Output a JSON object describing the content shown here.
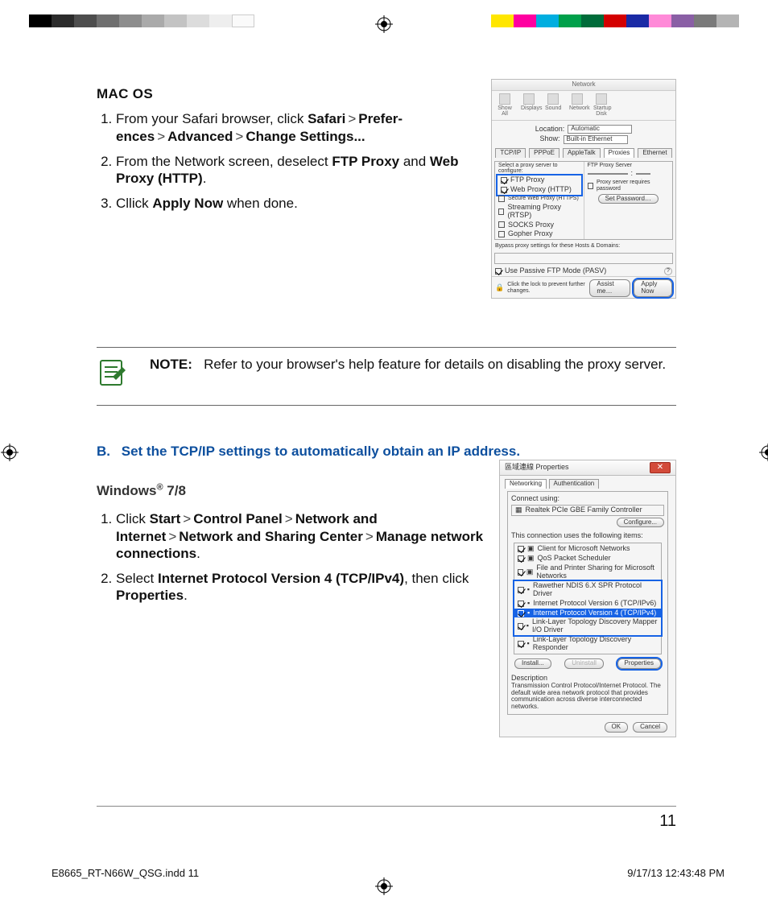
{
  "section_mac": {
    "heading": "MAC OS",
    "steps": [
      {
        "pre": "From your Safari browser, click ",
        "path": [
          "Safari",
          "Prefer-",
          "ences",
          "Advanced",
          "Change  Settings..."
        ]
      },
      {
        "pre": "From the Network screen, deselect ",
        "bold1": "FTP Proxy",
        "mid": " and ",
        "bold2": "Web Proxy (HTTP)",
        "post": "."
      },
      {
        "pre": "Cllick ",
        "bold1": "Apply Now",
        "post": " when done."
      }
    ]
  },
  "note": {
    "label": "NOTE:",
    "text": "Refer to your browser's help feature for details on disabling the proxy server."
  },
  "section_b": {
    "label": "B.",
    "text": "Set the TCP/IP settings to automatically obtain an IP address."
  },
  "section_win": {
    "heading_pre": "Windows",
    "heading_sup": "®",
    "heading_post": " 7/8",
    "steps": [
      {
        "pre": "Click ",
        "path": [
          "Start",
          "Control Panel",
          "Network and Internet",
          "Network and Sharing Center",
          "Manage network connections"
        ],
        "post": "."
      },
      {
        "pre": "Select ",
        "bold1": "Internet Protocol Version 4 (TCP/IPv4)",
        "mid": ", then click ",
        "bold2": "Properties",
        "post": "."
      }
    ]
  },
  "fig_mac": {
    "title": "Network",
    "toolbar": [
      "Show All",
      "Displays",
      "Sound",
      "Network",
      "Startup Disk"
    ],
    "location_label": "Location:",
    "location_value": "Automatic",
    "show_label": "Show:",
    "show_value": "Built-in Ethernet",
    "tabs": [
      "TCP/IP",
      "PPPoE",
      "AppleTalk",
      "Proxies",
      "Ethernet"
    ],
    "left_label": "Select a proxy server to configure:",
    "right_label": "FTP Proxy Server",
    "right_check": "Proxy server requires password",
    "right_btn": "Set Password…",
    "proxies": [
      "FTP Proxy",
      "Web Proxy (HTTP)",
      "Secure Web Proxy (HTTPS)",
      "Streaming Proxy (RTSP)",
      "SOCKS Proxy",
      "Gopher Proxy"
    ],
    "bypass": "Bypass proxy settings for these Hosts & Domains:",
    "pasv": "Use Passive FTP Mode (PASV)",
    "lock": "Click the lock to prevent further changes.",
    "assist": "Assist me…",
    "apply": "Apply Now"
  },
  "fig_win": {
    "title": "區域連線 Properties",
    "tabs": [
      "Networking",
      "Authentication"
    ],
    "connect": "Connect using:",
    "adapter": "Realtek PCIe GBE Family Controller",
    "configure": "Configure...",
    "uses": "This connection uses the following items:",
    "items": [
      "Client for Microsoft Networks",
      "QoS Packet Scheduler",
      "File and Printer Sharing for Microsoft Networks",
      "Rawether NDIS 6.X SPR Protocol Driver",
      "Internet Protocol Version 6 (TCP/IPv6)",
      "Internet Protocol Version 4 (TCP/IPv4)",
      "Link-Layer Topology Discovery Mapper I/O Driver",
      "Link-Layer Topology Discovery Responder"
    ],
    "install": "Install...",
    "uninstall": "Uninstall",
    "properties": "Properties",
    "desc_label": "Description",
    "desc": "Transmission Control Protocol/Internet Protocol. The default wide area network protocol that provides communication across diverse interconnected networks.",
    "ok": "OK",
    "cancel": "Cancel"
  },
  "footer": {
    "page": "11",
    "file": "E8665_RT-N66W_QSG.indd   11",
    "ts": "9/17/13   12:43:48 PM"
  }
}
